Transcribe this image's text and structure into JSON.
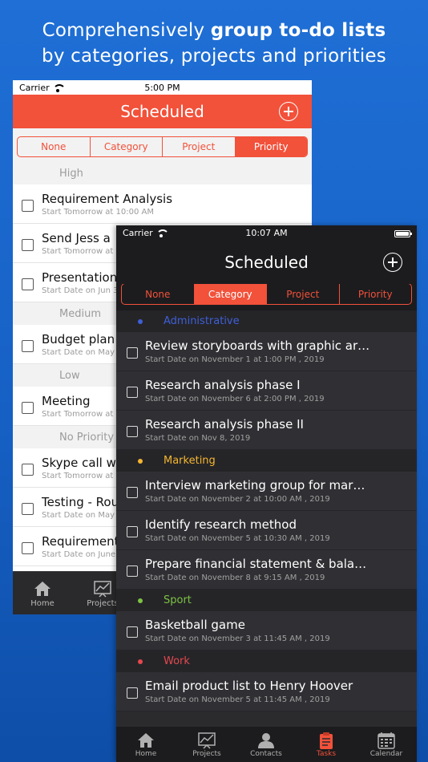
{
  "headline": {
    "line1_a": "Comprehensively ",
    "line1_b": "group to-do lists",
    "line2": "by categories, projects and priorities"
  },
  "light_phone": {
    "status": {
      "carrier": "Carrier",
      "time": "5:00 PM"
    },
    "title": "Scheduled",
    "segments": [
      "None",
      "Category",
      "Project",
      "Priority"
    ],
    "active_segment": "Priority",
    "sections": [
      {
        "label": "High",
        "rows": [
          {
            "title": "Requirement Analysis",
            "sub": "Start Tomorrow at 10:00 AM"
          },
          {
            "title": "Send Jess a",
            "sub": "Start Tomorrow at"
          },
          {
            "title": "Presentation",
            "sub": "Start Date on Jun 3"
          }
        ]
      },
      {
        "label": "Medium",
        "rows": [
          {
            "title": "Budget plan",
            "sub": "Start Date on May"
          }
        ]
      },
      {
        "label": "Low",
        "rows": [
          {
            "title": "Meeting",
            "sub": "Start Tomorrow at"
          }
        ]
      },
      {
        "label": "No Priority",
        "rows": [
          {
            "title": "Skype call w",
            "sub": "Start Tomorrow at"
          },
          {
            "title": "Testing - Rou",
            "sub": "Start Date on May"
          },
          {
            "title": "Requirement",
            "sub": "Start Date on June"
          }
        ]
      }
    ],
    "tabs": [
      "Home",
      "Projects"
    ]
  },
  "dark_phone": {
    "status": {
      "carrier": "Carrier",
      "time": "10:07 AM"
    },
    "title": "Scheduled",
    "segments": [
      "None",
      "Category",
      "Project",
      "Priority"
    ],
    "active_segment": "Category",
    "sections": [
      {
        "label": "Administrative",
        "color": "#3f5fd6",
        "rows": [
          {
            "title": "Review storyboards with graphic ar…",
            "sub": "Start Date on November 1 at 1:00 PM , 2019"
          },
          {
            "title": "Research analysis phase I",
            "sub": "Start Date on November 6 at 2:00 PM , 2019"
          },
          {
            "title": "Research analysis phase II",
            "sub": "Start Date on Nov 8, 2019"
          }
        ]
      },
      {
        "label": "Marketing",
        "color": "#f5b630",
        "rows": [
          {
            "title": "Interview marketing group for mar…",
            "sub": "Start Date on November 2 at 10:00 AM , 2019"
          },
          {
            "title": "Identify research method",
            "sub": "Start Date on November 5 at 10:30 AM , 2019"
          },
          {
            "title": "Prepare financial statement & bala…",
            "sub": "Start Date on November 8 at 9:15 AM , 2019"
          }
        ]
      },
      {
        "label": "Sport",
        "color": "#7dc243",
        "rows": [
          {
            "title": "Basketball game",
            "sub": "Start Date on November 3 at 11:45 AM , 2019"
          }
        ]
      },
      {
        "label": "Work",
        "color": "#e5484d",
        "rows": [
          {
            "title": "Email product list to Henry Hoover",
            "sub": "Start Date on November 5 at 11:45 AM , 2019"
          }
        ]
      }
    ],
    "tabs": [
      "Home",
      "Projects",
      "Contacts",
      "Tasks",
      "Calendar"
    ],
    "active_tab": "Tasks"
  },
  "colors": {
    "accent": "#f2513a",
    "background": "#1660c4"
  }
}
